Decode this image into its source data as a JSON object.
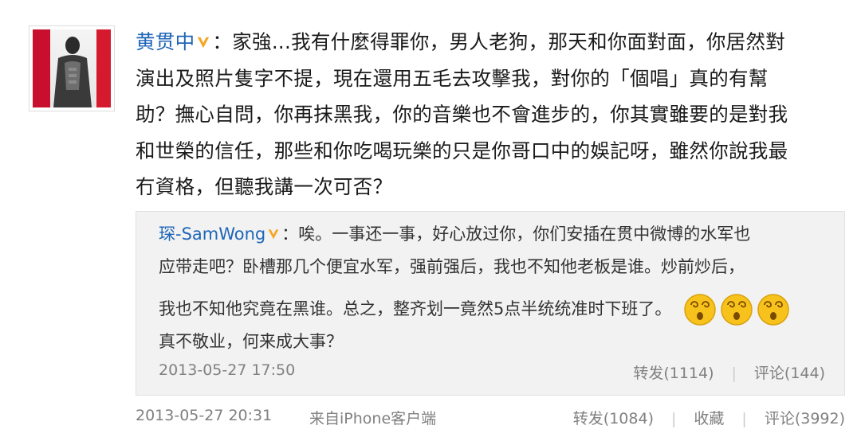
{
  "post": {
    "author": "黄贯中",
    "colon": "：",
    "lines": [
      "家強...我有什麼得罪你，男人老狗，那天和你面對面，你居然對",
      "演出及照片隻字不提，現在還用五毛去攻擊我，對你的「個唱」真的有幫",
      "助？撫心自問，你再抹黑我，你的音樂也不會進步的，你其實雖要的是對我",
      "和世榮的信任，那些和你吃喝玩樂的只是你哥口中的娛記呀，雖然你說我最",
      "冇資格，但聽我講一次可否？"
    ],
    "time": "2013-05-27 20:31",
    "source": "来自iPhone客户端",
    "actions": {
      "repost": "转发(1084)",
      "favorite": "收藏",
      "comment": "评论(3992)"
    },
    "separator": "|"
  },
  "repost": {
    "author": "琛-SamWong",
    "colon": "：",
    "lines": [
      "唉。一事还一事，好心放过你，你们安插在贯中微博的水军也",
      "应带走吧？卧槽那几个便宜水军，强前强后，我也不知他老板是谁。炒前炒后，",
      "我也不知他究竟在黑谁。总之，整齐划一竟然5点半统统准时下班了。",
      "真不敬业，何来成大事？"
    ],
    "emoji_icons": [
      "dizzy-face-icon",
      "dizzy-face-icon",
      "dizzy-face-icon"
    ],
    "time": "2013-05-27 17:50",
    "actions": {
      "repost": "转发(1114)",
      "comment": "评论(144)"
    },
    "separator": "|"
  },
  "colors": {
    "link": "#1e65b8",
    "text": "#1a1a1a",
    "meta": "#808080",
    "repost_bg": "#f2f2f2",
    "verified_badge": "#f5a623"
  }
}
